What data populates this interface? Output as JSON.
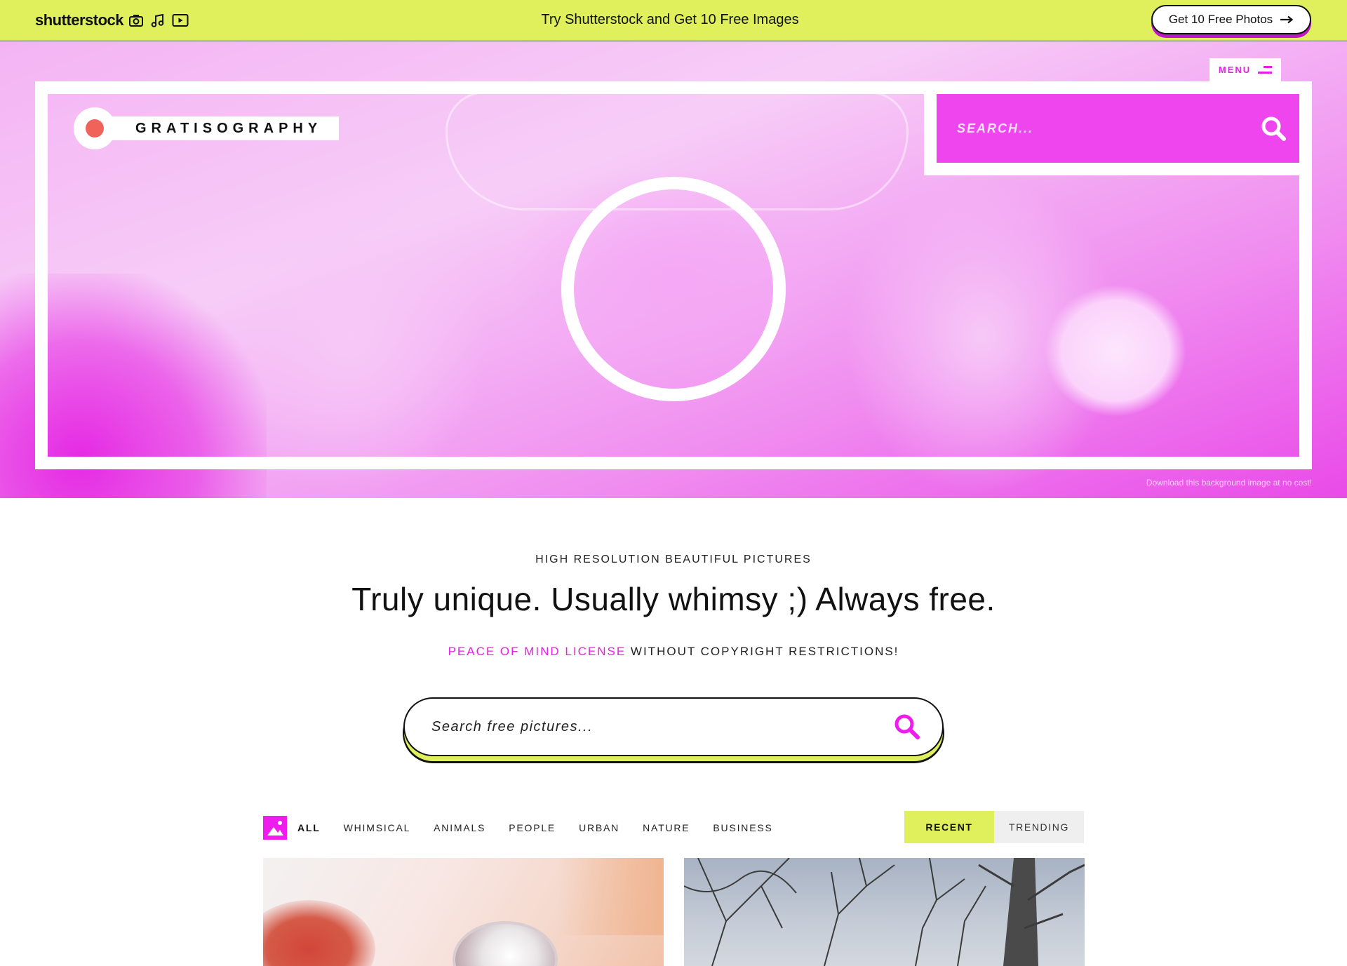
{
  "topbar": {
    "brand": "shutterstock",
    "icons": [
      "camera-icon",
      "music-note-icon",
      "video-play-icon"
    ],
    "promo_text": "Try Shutterstock and Get 10 Free Images",
    "button_label": "Get 10 Free Photos",
    "button_icon": "arrow-right-icon",
    "background_color": "#dff05c"
  },
  "hero": {
    "menu_label": "MENU",
    "brand_name": "GRATISOGRAPHY",
    "search_placeholder": "SEARCH...",
    "credit": "Download this background image at no cost!",
    "accent_color": "#ef45ee"
  },
  "intro": {
    "eyebrow": "HIGH RESOLUTION BEAUTIFUL PICTURES",
    "headline": "Truly unique. Usually whimsy ;) Always free.",
    "license_highlight": "PEACE OF MIND LICENSE",
    "license_rest": " WITHOUT COPYRIGHT RESTRICTIONS!"
  },
  "main_search": {
    "placeholder": "Search free pictures..."
  },
  "filters": {
    "categories": [
      "ALL",
      "WHIMSICAL",
      "ANIMALS",
      "PEOPLE",
      "URBAN",
      "NATURE",
      "BUSINESS"
    ],
    "active": "ALL",
    "sort": [
      "RECENT",
      "TRENDING"
    ],
    "active_sort": "RECENT"
  },
  "gallery": {
    "cards": [
      {
        "subject": "microphone photo"
      },
      {
        "subject": "bare trees photo"
      }
    ]
  }
}
